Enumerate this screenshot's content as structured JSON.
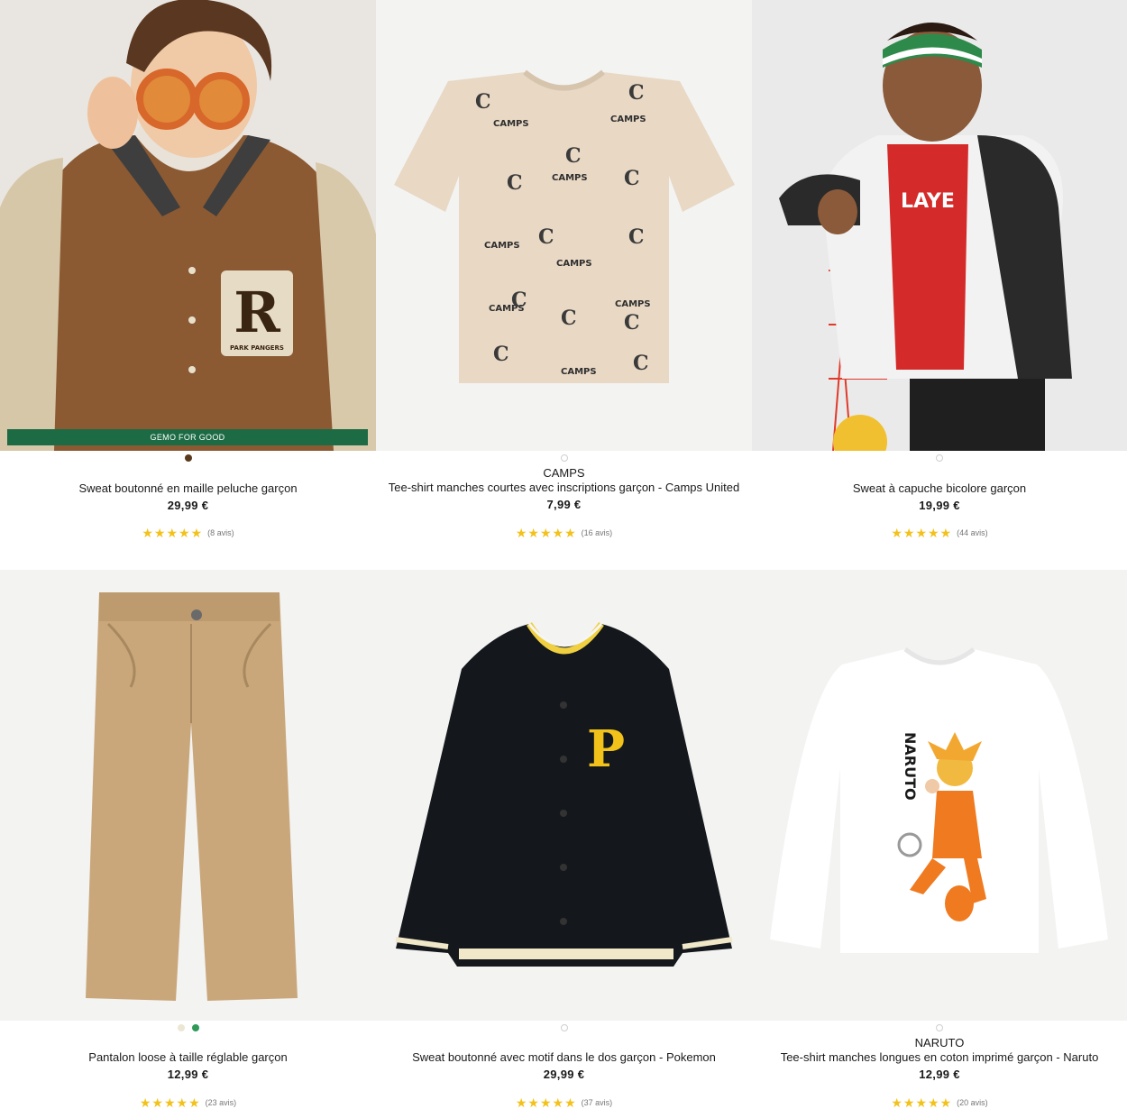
{
  "products": [
    {
      "badge": "GEMO FOR GOOD",
      "brand": "",
      "title": "Sweat boutonné en maille peluche garçon",
      "price": "29,99 €",
      "stars": "★★★★★",
      "rating": 4.5,
      "reviews": "(8 avis)",
      "swatches": [
        "#5a3a1c"
      ]
    },
    {
      "badge": "",
      "brand": "CAMPS",
      "title": "Tee-shirt manches courtes avec inscriptions garçon - Camps United",
      "price": "7,99 €",
      "stars": "★★★★★",
      "rating": 5,
      "reviews": "(16 avis)",
      "swatches": [
        "outline"
      ]
    },
    {
      "badge": "",
      "brand": "",
      "title": "Sweat à capuche bicolore garçon",
      "price": "19,99 €",
      "stars": "★★★★★",
      "rating": 5,
      "reviews": "(44 avis)",
      "swatches": [
        "outline"
      ]
    },
    {
      "badge": "",
      "brand": "",
      "title": "Pantalon loose à taille réglable garçon",
      "price": "12,99 €",
      "stars": "★★★★★",
      "rating": 4.5,
      "reviews": "(23 avis)",
      "swatches": [
        "#ece6d4",
        "#2f9a5a"
      ]
    },
    {
      "badge": "",
      "brand": "",
      "title": "Sweat boutonné avec motif dans le dos garçon - Pokemon",
      "price": "29,99 €",
      "stars": "★★★★★",
      "rating": 5,
      "reviews": "(37 avis)",
      "swatches": [
        "outline"
      ]
    },
    {
      "badge": "",
      "brand": "NARUTO",
      "title": "Tee-shirt manches longues en coton imprimé garçon - Naruto",
      "price": "12,99 €",
      "stars": "★★★★★",
      "rating": 5,
      "reviews": "(20 avis)",
      "swatches": [
        "outline"
      ]
    }
  ],
  "image_labels": {
    "jacket_letter": "R",
    "jacket_patch": "PARK PANGERS",
    "tee_print": "CAMPS",
    "bomber_letter": "P",
    "naruto_text": "NARUTO"
  },
  "colors": {
    "star": "#f2c21b",
    "badge": "#1d6b45"
  }
}
